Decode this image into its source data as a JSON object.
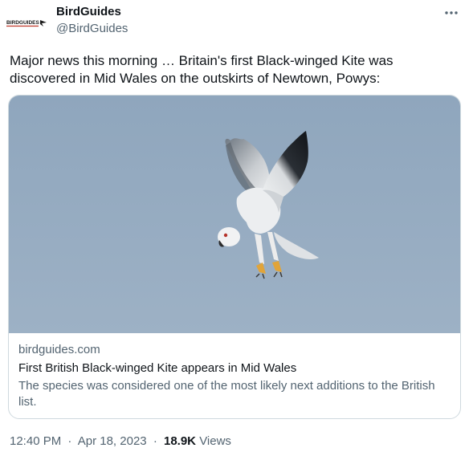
{
  "tweet": {
    "author": {
      "display_name": "BirdGuides",
      "handle": "@BirdGuides",
      "avatar_logo_text": "BIRDGUIDES"
    },
    "more_icon": "more-dots-icon",
    "text": "Major news this morning … Britain's first Black-winged Kite was discovered in Mid Wales on the outskirts of Newtown, Powys:",
    "link_card": {
      "image_subject": "black-winged-kite-photo",
      "domain": "birdguides.com",
      "title": "First British Black-winged Kite appears in Mid Wales",
      "description": "The species was considered one of the most likely next additions to the British list."
    },
    "meta": {
      "time": "12:40 PM",
      "separator": "·",
      "date": "Apr 18, 2023",
      "views_count": "18.9K",
      "views_label": "Views"
    }
  },
  "colors": {
    "text_primary": "#0f1419",
    "text_secondary": "#536471",
    "card_border": "#cfd9de",
    "sky": "#93a9bf"
  }
}
